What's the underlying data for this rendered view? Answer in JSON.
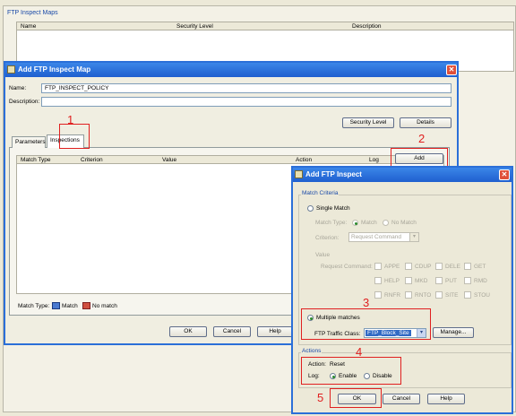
{
  "background": {
    "group_title": "FTP Inspect Maps",
    "columns": [
      "Name",
      "Security Level",
      "Description"
    ]
  },
  "dialog_main": {
    "title": "Add FTP  Inspect Map",
    "name_label": "Name:",
    "name_value": "FTP_INSPECT_POLICY",
    "description_label": "Description:",
    "description_value": "",
    "security_level_button": "Security Level",
    "details_button": "Details",
    "tabs": [
      "Parameters",
      "Inspections"
    ],
    "columns": [
      "Match Type",
      "Criterion",
      "Value",
      "Action",
      "Log"
    ],
    "add_button": "Add",
    "match_type_label": "Match Type:",
    "legend_match": "Match",
    "legend_no_match": "No match",
    "ok_button": "OK",
    "cancel_button": "Cancel",
    "help_button": "Help"
  },
  "dialog_inspect": {
    "title": "Add FTP Inspect",
    "match_criteria_title": "Match Criteria",
    "single_match_label": "Single Match",
    "match_type_label": "Match Type:",
    "match_option": "Match",
    "no_match_option": "No Match",
    "criterion_label": "Criterion:",
    "criterion_value": "Request Command",
    "value_label": "Value",
    "request_command_label": "Request Command:",
    "commands_row1": [
      "APPE",
      "CDUP",
      "DELE",
      "GET"
    ],
    "commands_row2": [
      "HELP",
      "MKD",
      "PUT",
      "RMD"
    ],
    "commands_row3": [
      "RNFR",
      "RNTO",
      "SITE",
      "STOU"
    ],
    "multiple_matches_label": "Multiple matches",
    "traffic_class_label": "FTP Traffic Class:",
    "traffic_class_value": "FTP_Block_Site",
    "manage_button": "Manage...",
    "actions_title": "Actions",
    "action_label": "Action:",
    "action_value": "Reset",
    "log_label": "Log:",
    "enable_label": "Enable",
    "disable_label": "Disable",
    "ok_button": "OK",
    "cancel_button": "Cancel",
    "help_button": "Help"
  },
  "annotations": [
    "1",
    "2",
    "3",
    "4",
    "5"
  ],
  "colors": {
    "titlebar": "#1f5fcf",
    "annotation_red": "#e02020",
    "group_title": "#1a4aa8",
    "selected_blue": "#316ac5"
  }
}
